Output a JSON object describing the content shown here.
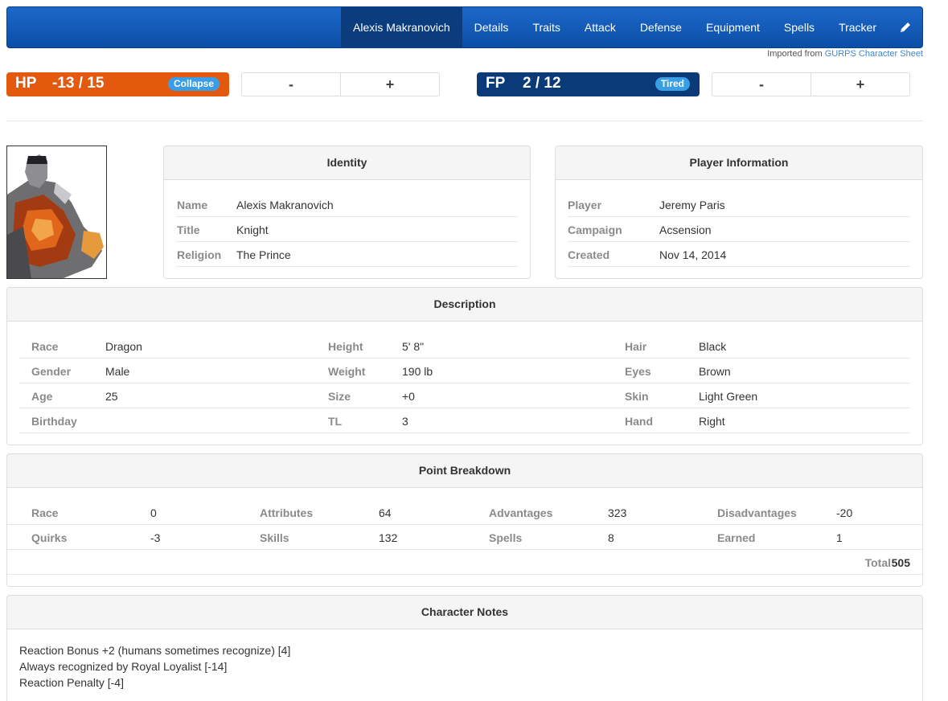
{
  "nav": {
    "items": [
      {
        "label": "Alexis Makranovich",
        "active": true
      },
      {
        "label": "Details"
      },
      {
        "label": "Traits"
      },
      {
        "label": "Attack"
      },
      {
        "label": "Defense"
      },
      {
        "label": "Equipment"
      },
      {
        "label": "Spells"
      },
      {
        "label": "Tracker"
      }
    ],
    "edit_icon": "pencil-icon",
    "imported_prefix": "Imported from",
    "imported_link": "GURPS Character Sheet"
  },
  "hp": {
    "label": "HP",
    "value": "-13 / 15",
    "badge": "Collapse",
    "color": "#e35a0f"
  },
  "fp": {
    "label": "FP",
    "value": "2 / 12",
    "badge": "Tired",
    "color": "#0b3a78"
  },
  "stepper": {
    "minus": "-",
    "plus": "+"
  },
  "identity": {
    "title": "Identity",
    "rows": [
      {
        "key": "Name",
        "value": "Alexis Makranovich"
      },
      {
        "key": "Title",
        "value": "Knight"
      },
      {
        "key": "Religion",
        "value": "The Prince"
      }
    ]
  },
  "player": {
    "title": "Player Information",
    "rows": [
      {
        "key": "Player",
        "value": "Jeremy Paris"
      },
      {
        "key": "Campaign",
        "value": "Acsension"
      },
      {
        "key": "Created",
        "value": "Nov 14, 2014"
      }
    ]
  },
  "description": {
    "title": "Description",
    "rows": [
      [
        {
          "key": "Race",
          "value": "Dragon"
        },
        {
          "key": "Height",
          "value": "5' 8\""
        },
        {
          "key": "Hair",
          "value": "Black"
        }
      ],
      [
        {
          "key": "Gender",
          "value": "Male"
        },
        {
          "key": "Weight",
          "value": "190 lb"
        },
        {
          "key": "Eyes",
          "value": "Brown"
        }
      ],
      [
        {
          "key": "Age",
          "value": "25"
        },
        {
          "key": "Size",
          "value": "+0"
        },
        {
          "key": "Skin",
          "value": "Light Green"
        }
      ],
      [
        {
          "key": "Birthday",
          "value": ""
        },
        {
          "key": "TL",
          "value": "3"
        },
        {
          "key": "Hand",
          "value": "Right"
        }
      ]
    ]
  },
  "points": {
    "title": "Point Breakdown",
    "rows": [
      [
        {
          "key": "Race",
          "value": "0"
        },
        {
          "key": "Attributes",
          "value": "64"
        },
        {
          "key": "Advantages",
          "value": "323"
        },
        {
          "key": "Disadvantages",
          "value": "-20"
        }
      ],
      [
        {
          "key": "Quirks",
          "value": "-3"
        },
        {
          "key": "Skills",
          "value": "132"
        },
        {
          "key": "Spells",
          "value": "8"
        },
        {
          "key": "Earned",
          "value": "1"
        }
      ]
    ],
    "total_label": "Total",
    "total_value": "505"
  },
  "notes": {
    "title": "Character Notes",
    "lines": [
      "Reaction Bonus +2 (humans sometimes recognize) [4]",
      "Always recognized by Royal Loyalist [-14]",
      "Reaction Penalty [-4]"
    ]
  }
}
